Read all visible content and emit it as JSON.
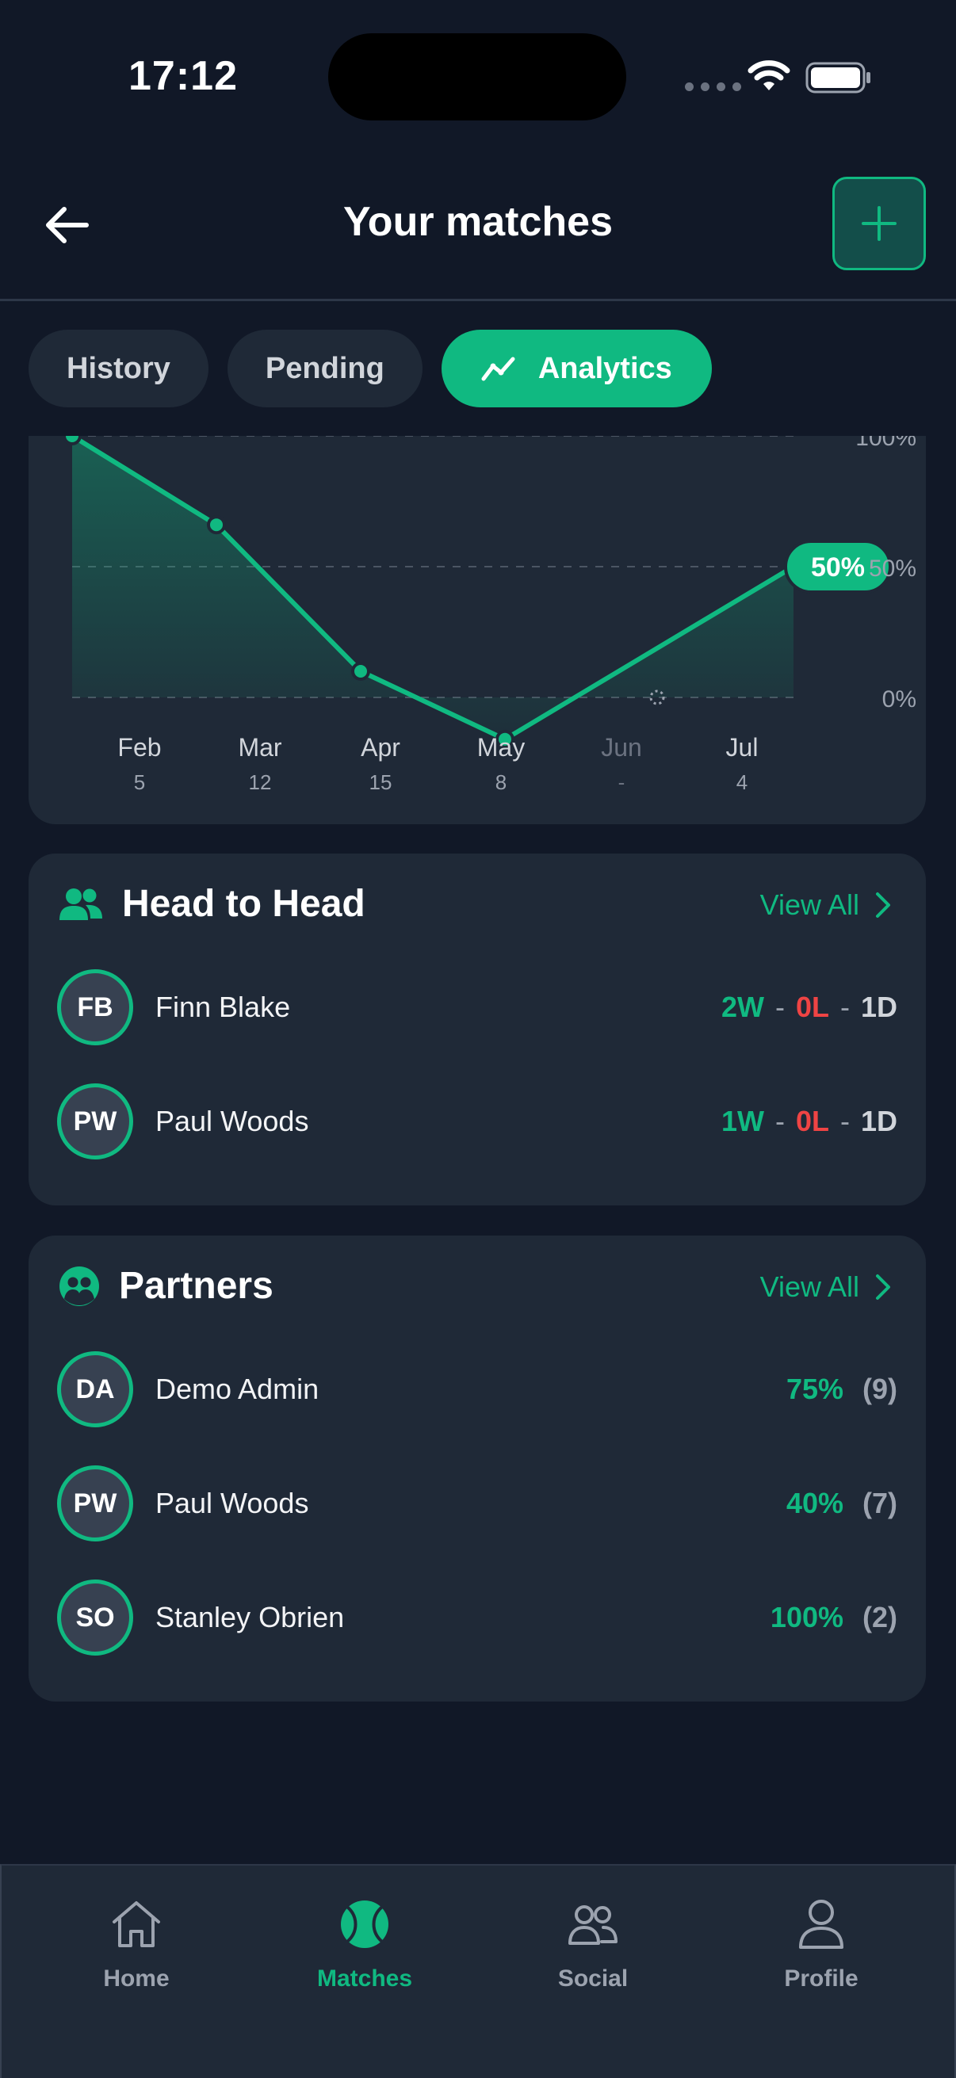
{
  "status": {
    "time": "17:12"
  },
  "header": {
    "title": "Your matches"
  },
  "tabs": [
    {
      "label": "History",
      "active": false
    },
    {
      "label": "Pending",
      "active": false
    },
    {
      "label": "Analytics",
      "active": true,
      "icon": "trend-icon"
    }
  ],
  "chart_data": {
    "type": "line",
    "categories": [
      "Feb",
      "Mar",
      "Apr",
      "May",
      "Jun",
      "Jul"
    ],
    "match_counts": [
      "5",
      "12",
      "15",
      "8",
      "-",
      "4"
    ],
    "y_tick_labels": [
      "100%",
      "50%",
      "0%"
    ],
    "ylim": [
      0,
      100
    ],
    "series": [
      {
        "values": [
          100,
          66,
          10,
          -16,
          null,
          50
        ]
      }
    ],
    "series_note": "values estimated; line partially scrolled out of view",
    "last_value_label": "50%",
    "grid": "dashed",
    "color": "#10b981"
  },
  "head_to_head": {
    "title": "Head to Head",
    "view_all": "View All",
    "rows": [
      {
        "initials": "FB",
        "name": "Finn Blake",
        "w": "2W",
        "l": "0L",
        "d": "1D",
        "sep": "-"
      },
      {
        "initials": "PW",
        "name": "Paul Woods",
        "w": "1W",
        "l": "0L",
        "d": "1D",
        "sep": "-"
      }
    ]
  },
  "partners": {
    "title": "Partners",
    "view_all": "View All",
    "rows": [
      {
        "initials": "DA",
        "name": "Demo Admin",
        "pct": "75%",
        "count": "(9)"
      },
      {
        "initials": "PW",
        "name": "Paul Woods",
        "pct": "40%",
        "count": "(7)"
      },
      {
        "initials": "SO",
        "name": "Stanley Obrien",
        "pct": "100%",
        "count": "(2)"
      }
    ]
  },
  "nav": [
    {
      "label": "Home",
      "icon": "home-icon",
      "active": false
    },
    {
      "label": "Matches",
      "icon": "tennis-ball-icon",
      "active": true
    },
    {
      "label": "Social",
      "icon": "people-icon",
      "active": false
    },
    {
      "label": "Profile",
      "icon": "person-icon",
      "active": false
    }
  ],
  "colors": {
    "accent": "#10b981",
    "loss": "#ef4444",
    "bg": "#111827",
    "card": "#1f2937"
  }
}
